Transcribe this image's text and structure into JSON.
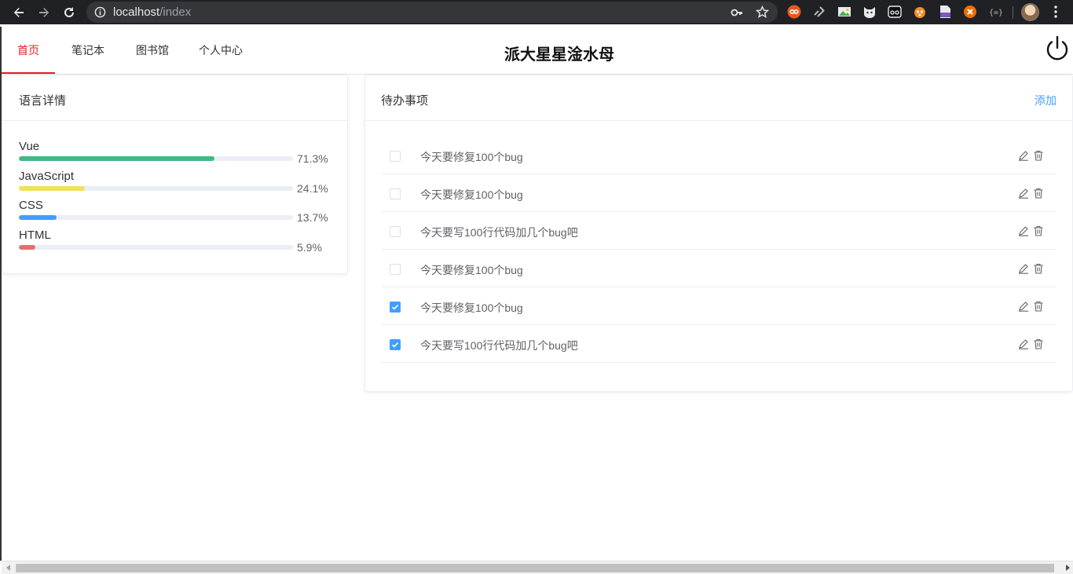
{
  "browser": {
    "url_host": "localhost",
    "url_path": "/index",
    "extension_icons": [
      "infinity-extension-icon",
      "link-extension-icon",
      "image-extension-icon",
      "cat-extension-icon",
      "camera-extension-icon",
      "fox-extension-icon",
      "pdf-extension-icon",
      "close-circle-extension-icon",
      "json-extension-icon"
    ]
  },
  "nav": {
    "tabs": [
      {
        "label": "首页",
        "active": true
      },
      {
        "label": "笔记本",
        "active": false
      },
      {
        "label": "图书馆",
        "active": false
      },
      {
        "label": "个人中心",
        "active": false
      }
    ],
    "site_title": "派大星星淦水母"
  },
  "languages": {
    "title": "语言详情",
    "items": [
      {
        "name": "Vue",
        "percent_label": "71.3%",
        "value": 71.3,
        "color": "#42b983"
      },
      {
        "name": "JavaScript",
        "percent_label": "24.1%",
        "value": 24.1,
        "color": "#f1e05a"
      },
      {
        "name": "CSS",
        "percent_label": "13.7%",
        "value": 13.7,
        "color": "#409eff"
      },
      {
        "name": "HTML",
        "percent_label": "5.9%",
        "value": 5.9,
        "color": "#e96f6f"
      }
    ]
  },
  "todos": {
    "title": "待办事项",
    "add_label": "添加",
    "items": [
      {
        "text": "今天要修复100个bug",
        "checked": false
      },
      {
        "text": "今天要修复100个bug",
        "checked": false
      },
      {
        "text": "今天要写100行代码加几个bug吧",
        "checked": false
      },
      {
        "text": "今天要修复100个bug",
        "checked": false
      },
      {
        "text": "今天要修复100个bug",
        "checked": true
      },
      {
        "text": "今天要写100行代码加几个bug吧",
        "checked": true
      }
    ]
  },
  "colors": {
    "accent": "#409eff",
    "active_tab": "#e02020"
  }
}
